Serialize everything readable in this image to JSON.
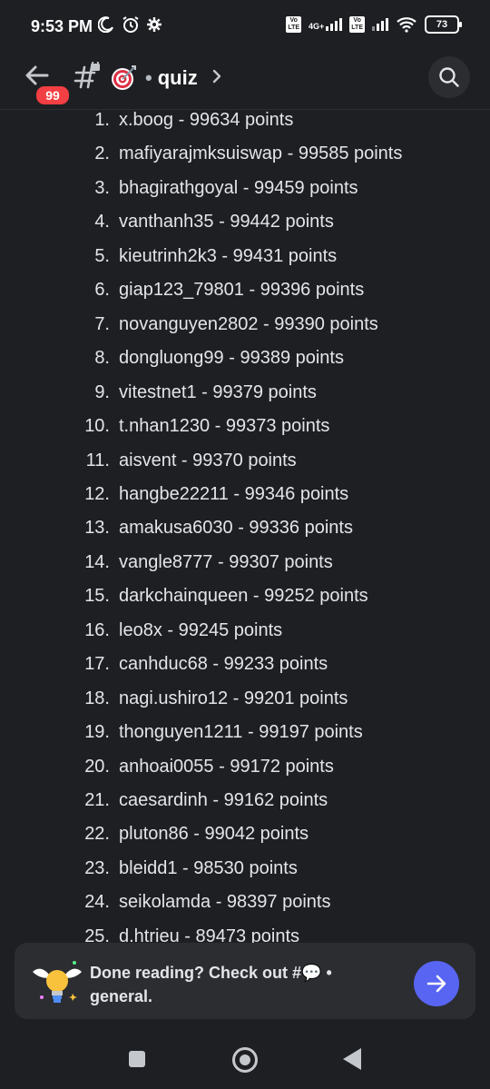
{
  "status_bar": {
    "time": "9:53 PM",
    "network": "4G+",
    "battery": "73"
  },
  "header": {
    "badge_count": "99",
    "channel_emoji": "🎯",
    "channel_name": "quiz",
    "separator": "•"
  },
  "leaderboard": [
    {
      "rank": "1.",
      "text": "x.boog - 99634 points"
    },
    {
      "rank": "2.",
      "text": "mafiyarajmksuiswap - 99585 points"
    },
    {
      "rank": "3.",
      "text": "bhagirathgoyal - 99459 points"
    },
    {
      "rank": "4.",
      "text": "vanthanh35 - 99442 points"
    },
    {
      "rank": "5.",
      "text": "kieutrinh2k3 - 99431 points"
    },
    {
      "rank": "6.",
      "text": "giap123_79801 - 99396 points"
    },
    {
      "rank": "7.",
      "text": "novanguyen2802 - 99390 points"
    },
    {
      "rank": "8.",
      "text": "dongluong99 - 99389 points"
    },
    {
      "rank": "9.",
      "text": "vitestnet1 - 99379 points"
    },
    {
      "rank": "10.",
      "text": "t.nhan1230 - 99373 points"
    },
    {
      "rank": "11.",
      "text": "aisvent - 99370 points"
    },
    {
      "rank": "12.",
      "text": "hangbe22211 - 99346 points"
    },
    {
      "rank": "13.",
      "text": "amakusa6030 - 99336 points"
    },
    {
      "rank": "14.",
      "text": "vangle8777 - 99307 points"
    },
    {
      "rank": "15.",
      "text": "darkchainqueen - 99252 points"
    },
    {
      "rank": "16.",
      "text": "leo8x - 99245 points"
    },
    {
      "rank": "17.",
      "text": "canhduc68 - 99233 points"
    },
    {
      "rank": "18.",
      "text": "nagi.ushiro12 - 99201 points"
    },
    {
      "rank": "19.",
      "text": "thonguyen1211 - 99197 points"
    },
    {
      "rank": "20.",
      "text": "anhoai0055 - 99172 points"
    },
    {
      "rank": "21.",
      "text": "caesardinh - 99162 points"
    },
    {
      "rank": "22.",
      "text": "pluton86 - 99042 points"
    },
    {
      "rank": "23.",
      "text": "bleidd1 - 98530 points"
    },
    {
      "rank": "24.",
      "text": "seikolamda - 98397 points"
    },
    {
      "rank": "25.",
      "text": "d.htrieu - 89473 points"
    }
  ],
  "banner": {
    "text": "Done reading? Check out #💬 • general."
  },
  "icons": {
    "back": "arrow-left-icon",
    "channel": "locked-text-channel-icon",
    "search": "search-icon",
    "go": "arrow-right-icon"
  },
  "colors": {
    "background": "#1e1f23",
    "badge": "#f23f43",
    "accent": "#5865f2"
  }
}
